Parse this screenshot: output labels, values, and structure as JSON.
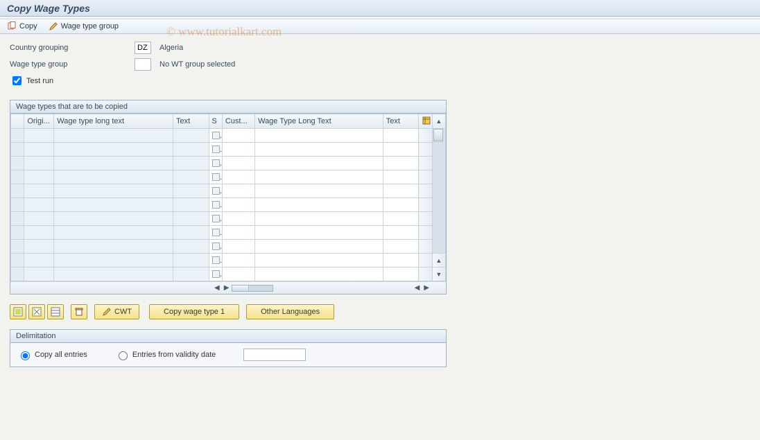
{
  "title": "Copy Wage Types",
  "toolbar": {
    "copy_label": "Copy",
    "wage_type_group_label": "Wage type group"
  },
  "form": {
    "country_grouping_label": "Country grouping",
    "country_grouping_value": "DZ",
    "country_grouping_text": "Algeria",
    "wage_type_group_label": "Wage type group",
    "wage_type_group_value": "",
    "wage_type_group_text": "No WT group selected",
    "test_run_label": "Test run",
    "test_run_checked": true
  },
  "grid": {
    "title": "Wage types that are to be copied",
    "columns": [
      "",
      "Origi...",
      "Wage type long text",
      "Text",
      "S",
      "Cust...",
      "Wage Type Long Text",
      "Text"
    ],
    "row_count": 11
  },
  "buttons": {
    "cwt_label": "CWT",
    "copy_wt1_label": "Copy wage type 1",
    "other_lang_label": "Other Languages"
  },
  "delimitation": {
    "title": "Delimitation",
    "copy_all_label": "Copy all entries",
    "from_date_label": "Entries from validity date",
    "selected": "copy_all",
    "date_value": ""
  },
  "watermark": "© www.tutorialkart.com"
}
